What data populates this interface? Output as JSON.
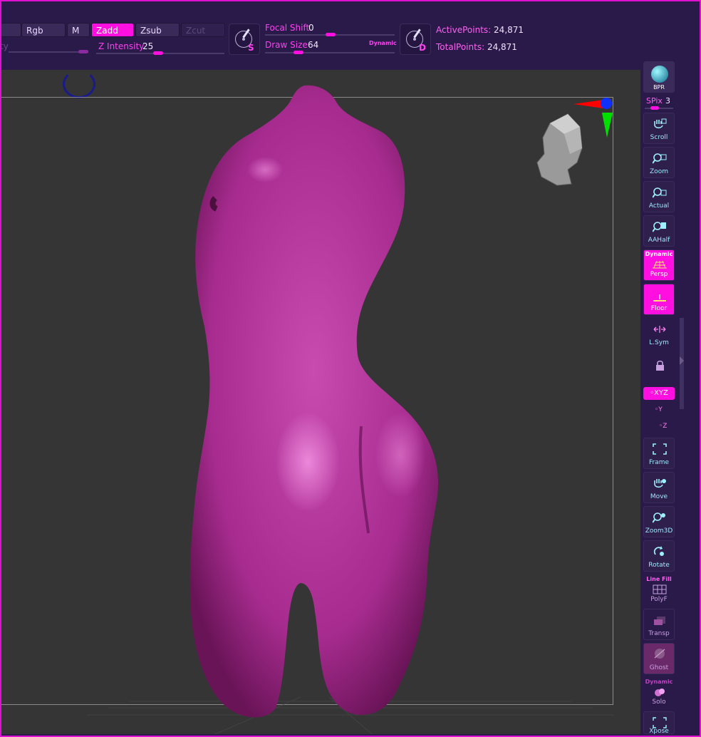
{
  "toolbar": {
    "rgb_label": "Rgb",
    "m_label": "M",
    "zadd_label": "Zadd",
    "zsub_label": "Zsub",
    "zcut_label": "Zcut",
    "intensity_cut_label": "ty",
    "z_intensity_label": "Z Intensity",
    "z_intensity_value": "25",
    "focal_shift_label": "Focal Shift",
    "focal_shift_value": "0",
    "draw_size_label": "Draw Size",
    "draw_size_value": "64",
    "dynamic_label": "Dynamic",
    "stroke_icon_letter": "S",
    "alpha_icon_letter": "D",
    "active_points_label": "ActivePoints:",
    "active_points_value": "24,871",
    "total_points_label": "TotalPoints:",
    "total_points_value": "24,871"
  },
  "right_shelf": {
    "bpr_label": "BPR",
    "spix_label": "SPix",
    "spix_value": "3",
    "buttons": [
      {
        "label": "Scroll",
        "icon": "hand-icon"
      },
      {
        "label": "Zoom",
        "icon": "magnifier-icon"
      },
      {
        "label": "Actual",
        "icon": "magnifier-icon"
      },
      {
        "label": "AAHalf",
        "icon": "magnifier-icon"
      },
      {
        "label": "Persp",
        "top": "Dynamic",
        "icon": "grid-icon"
      },
      {
        "label": "Floor",
        "icon": "floor-icon"
      },
      {
        "label": "L.Sym",
        "icon": "symmetry-icon"
      },
      {
        "label": "",
        "icon": "lock-icon"
      },
      {
        "label": "Frame",
        "icon": "frame-icon"
      },
      {
        "label": "Move",
        "icon": "hand-icon"
      },
      {
        "label": "Zoom3D",
        "icon": "magnifier-icon"
      },
      {
        "label": "Rotate",
        "icon": "rotate-icon"
      },
      {
        "label": "PolyF",
        "top": "Line Fill",
        "icon": "polyframe-icon"
      },
      {
        "label": "Transp",
        "icon": "transparency-icon"
      },
      {
        "label": "Ghost",
        "icon": "ghost-icon"
      },
      {
        "label": "Solo",
        "top": "Dynamic",
        "icon": "solo-icon"
      },
      {
        "label": "Xpose",
        "icon": "xpose-icon"
      }
    ],
    "xyz_label": "◦XYZ",
    "y_label": "◦Y",
    "z_label": "◦Z"
  },
  "colors": {
    "accent": "#ff10e0",
    "ui_bg": "#2a1a4a",
    "viewport_bg": "#353535",
    "model": "#b3369b"
  }
}
